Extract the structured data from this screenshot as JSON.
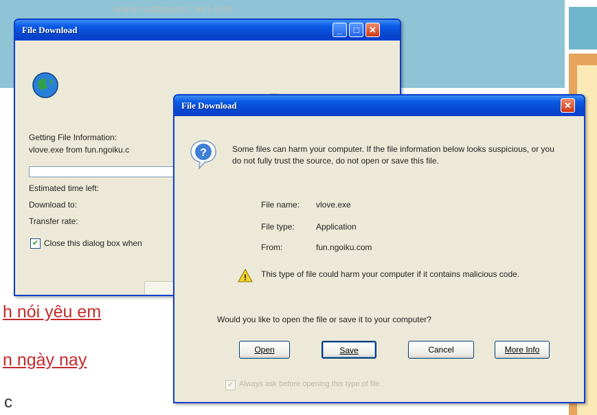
{
  "background_page": {
    "banner_url": "www.nuttmusic.net.info",
    "links": [
      "h nói yêu em",
      "n ngày nay"
    ],
    "fragments": [
      "c"
    ]
  },
  "progress_dialog": {
    "title": "File Download",
    "getting_info": "Getting File Information:",
    "file_from": "vlove.exe from fun.ngoiku.c",
    "estimated_time": "Estimated time left:",
    "download_to": "Download to:",
    "transfer_rate": "Transfer rate:",
    "close_when_done": "Close this dialog box when"
  },
  "security_dialog": {
    "title": "File Download",
    "warning": "Some files can harm your computer. If the file information below looks suspicious, or you do not fully trust the source, do not open or save this file.",
    "file_name_label": "File name:",
    "file_name": "vlove.exe",
    "file_type_label": "File type:",
    "file_type": "Application",
    "from_label": "From:",
    "from": "fun.ngoiku.com",
    "caution": "This type of file could harm your computer if it contains malicious code.",
    "question": "Would you like to open the file or save it to your computer?",
    "buttons": {
      "open": "Open",
      "save": "Save",
      "cancel": "Cancel",
      "more_info": "More Info"
    },
    "always_ask": "Always ask before opening this type of file"
  }
}
